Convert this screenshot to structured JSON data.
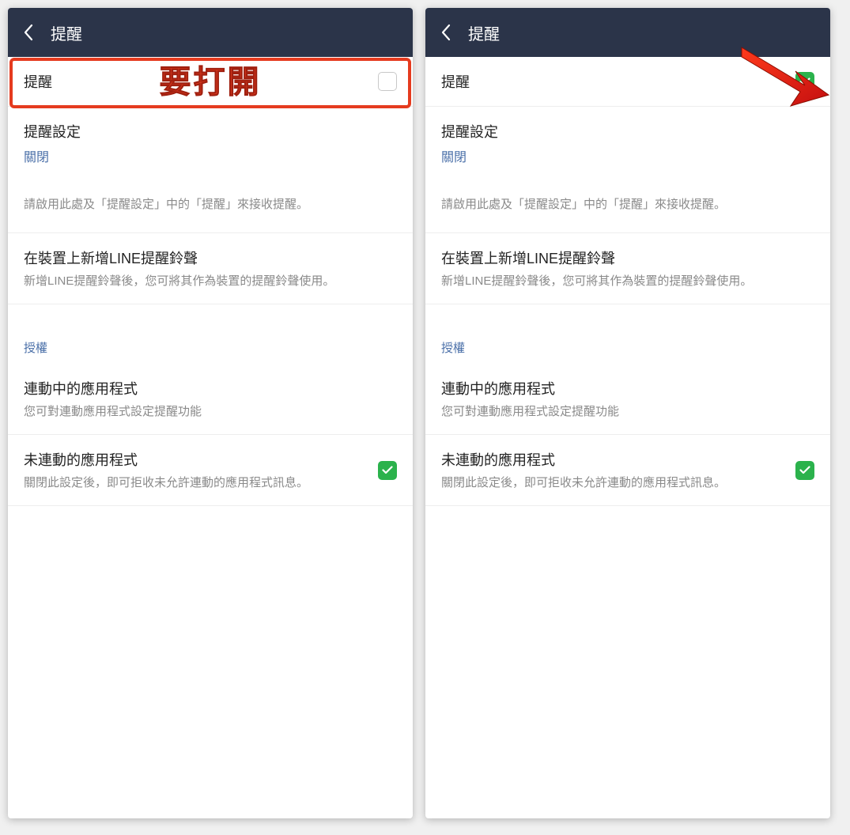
{
  "annotations": {
    "highlight_label": "要打開"
  },
  "colors": {
    "header_bg": "#2b3449",
    "accent_red": "#e53b1f",
    "link_blue": "#4a6fa8",
    "check_green": "#2bb24c"
  },
  "left": {
    "header_title": "提醒",
    "row_notify": {
      "label": "提醒",
      "checked": false
    },
    "row_settings": {
      "label": "提醒設定",
      "status": "關閉"
    },
    "hint": "請啟用此處及「提醒設定」中的「提醒」來接收提醒。",
    "row_ringtone": {
      "label": "在裝置上新增LINE提醒鈴聲",
      "sub": "新增LINE提醒鈴聲後，您可將其作為裝置的提醒鈴聲使用。"
    },
    "section_auth": "授權",
    "row_linked": {
      "label": "連動中的應用程式",
      "sub": "您可對連動應用程式設定提醒功能"
    },
    "row_unlinked": {
      "label": "未連動的應用程式",
      "sub": "關閉此設定後，即可拒收未允許連動的應用程式訊息。",
      "checked": true
    }
  },
  "right": {
    "header_title": "提醒",
    "row_notify": {
      "label": "提醒",
      "checked": true
    },
    "row_settings": {
      "label": "提醒設定",
      "status": "關閉"
    },
    "hint": "請啟用此處及「提醒設定」中的「提醒」來接收提醒。",
    "row_ringtone": {
      "label": "在裝置上新增LINE提醒鈴聲",
      "sub": "新增LINE提醒鈴聲後，您可將其作為裝置的提醒鈴聲使用。"
    },
    "section_auth": "授權",
    "row_linked": {
      "label": "連動中的應用程式",
      "sub": "您可對連動應用程式設定提醒功能"
    },
    "row_unlinked": {
      "label": "未連動的應用程式",
      "sub": "關閉此設定後，即可拒收未允許連動的應用程式訊息。",
      "checked": true
    }
  }
}
